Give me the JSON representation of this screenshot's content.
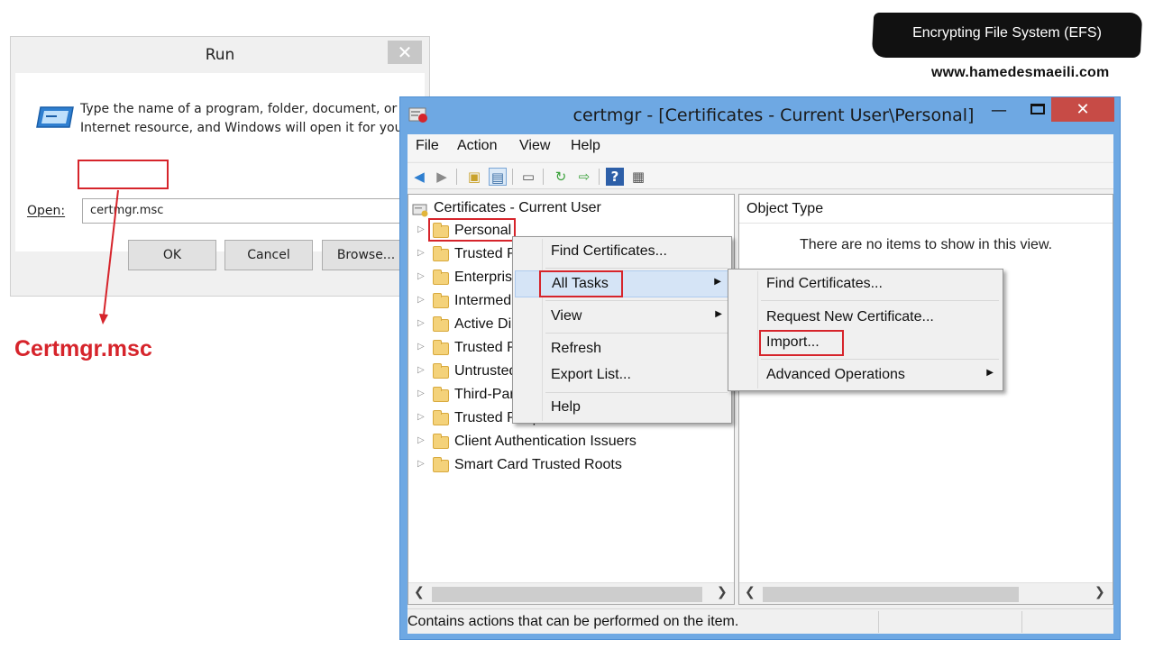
{
  "banner": {
    "title": "Encrypting File System (EFS)",
    "site": "www.hamedesmaeili.com"
  },
  "run_dialog": {
    "title": "Run",
    "close_glyph": "✕",
    "description": "Type the name of a program, folder, document, or Internet resource, and Windows will open it for you.",
    "open_label": "Open:",
    "open_value": "certmgr.msc",
    "ok_label": "OK",
    "cancel_label": "Cancel",
    "browse_label": "Browse..."
  },
  "annotation": {
    "label": "Certmgr.msc",
    "color": "#d6242b"
  },
  "certmgr": {
    "title": "certmgr - [Certificates - Current User\\Personal]",
    "menu": [
      "File",
      "Action",
      "View",
      "Help"
    ],
    "tree": {
      "root": "Certificates - Current User",
      "items": [
        "Personal",
        "Trusted Root Certification Authorities",
        "Enterprise Trust",
        "Intermediate Certification Authorities",
        "Active Directory User Object",
        "Trusted Publishers",
        "Untrusted Certificates",
        "Third-Party Root Certification Authorities",
        "Trusted People",
        "Client Authentication Issuers",
        "Smart Card Trusted Roots"
      ]
    },
    "list": {
      "header": "Object Type",
      "empty_message": "There are no items to show in this view."
    },
    "status": "Contains actions that can be performed on the item.",
    "context_menu": {
      "items": [
        "Find Certificates...",
        "All Tasks",
        "View",
        "Refresh",
        "Export List...",
        "Help"
      ],
      "active": "All Tasks"
    },
    "submenu": {
      "items": [
        "Find Certificates...",
        "Request New Certificate...",
        "Import...",
        "Advanced Operations"
      ]
    },
    "colors": {
      "titlebar": "#6ea8e3",
      "close": "#c74b46",
      "highlight": "#d5e4f6"
    }
  }
}
